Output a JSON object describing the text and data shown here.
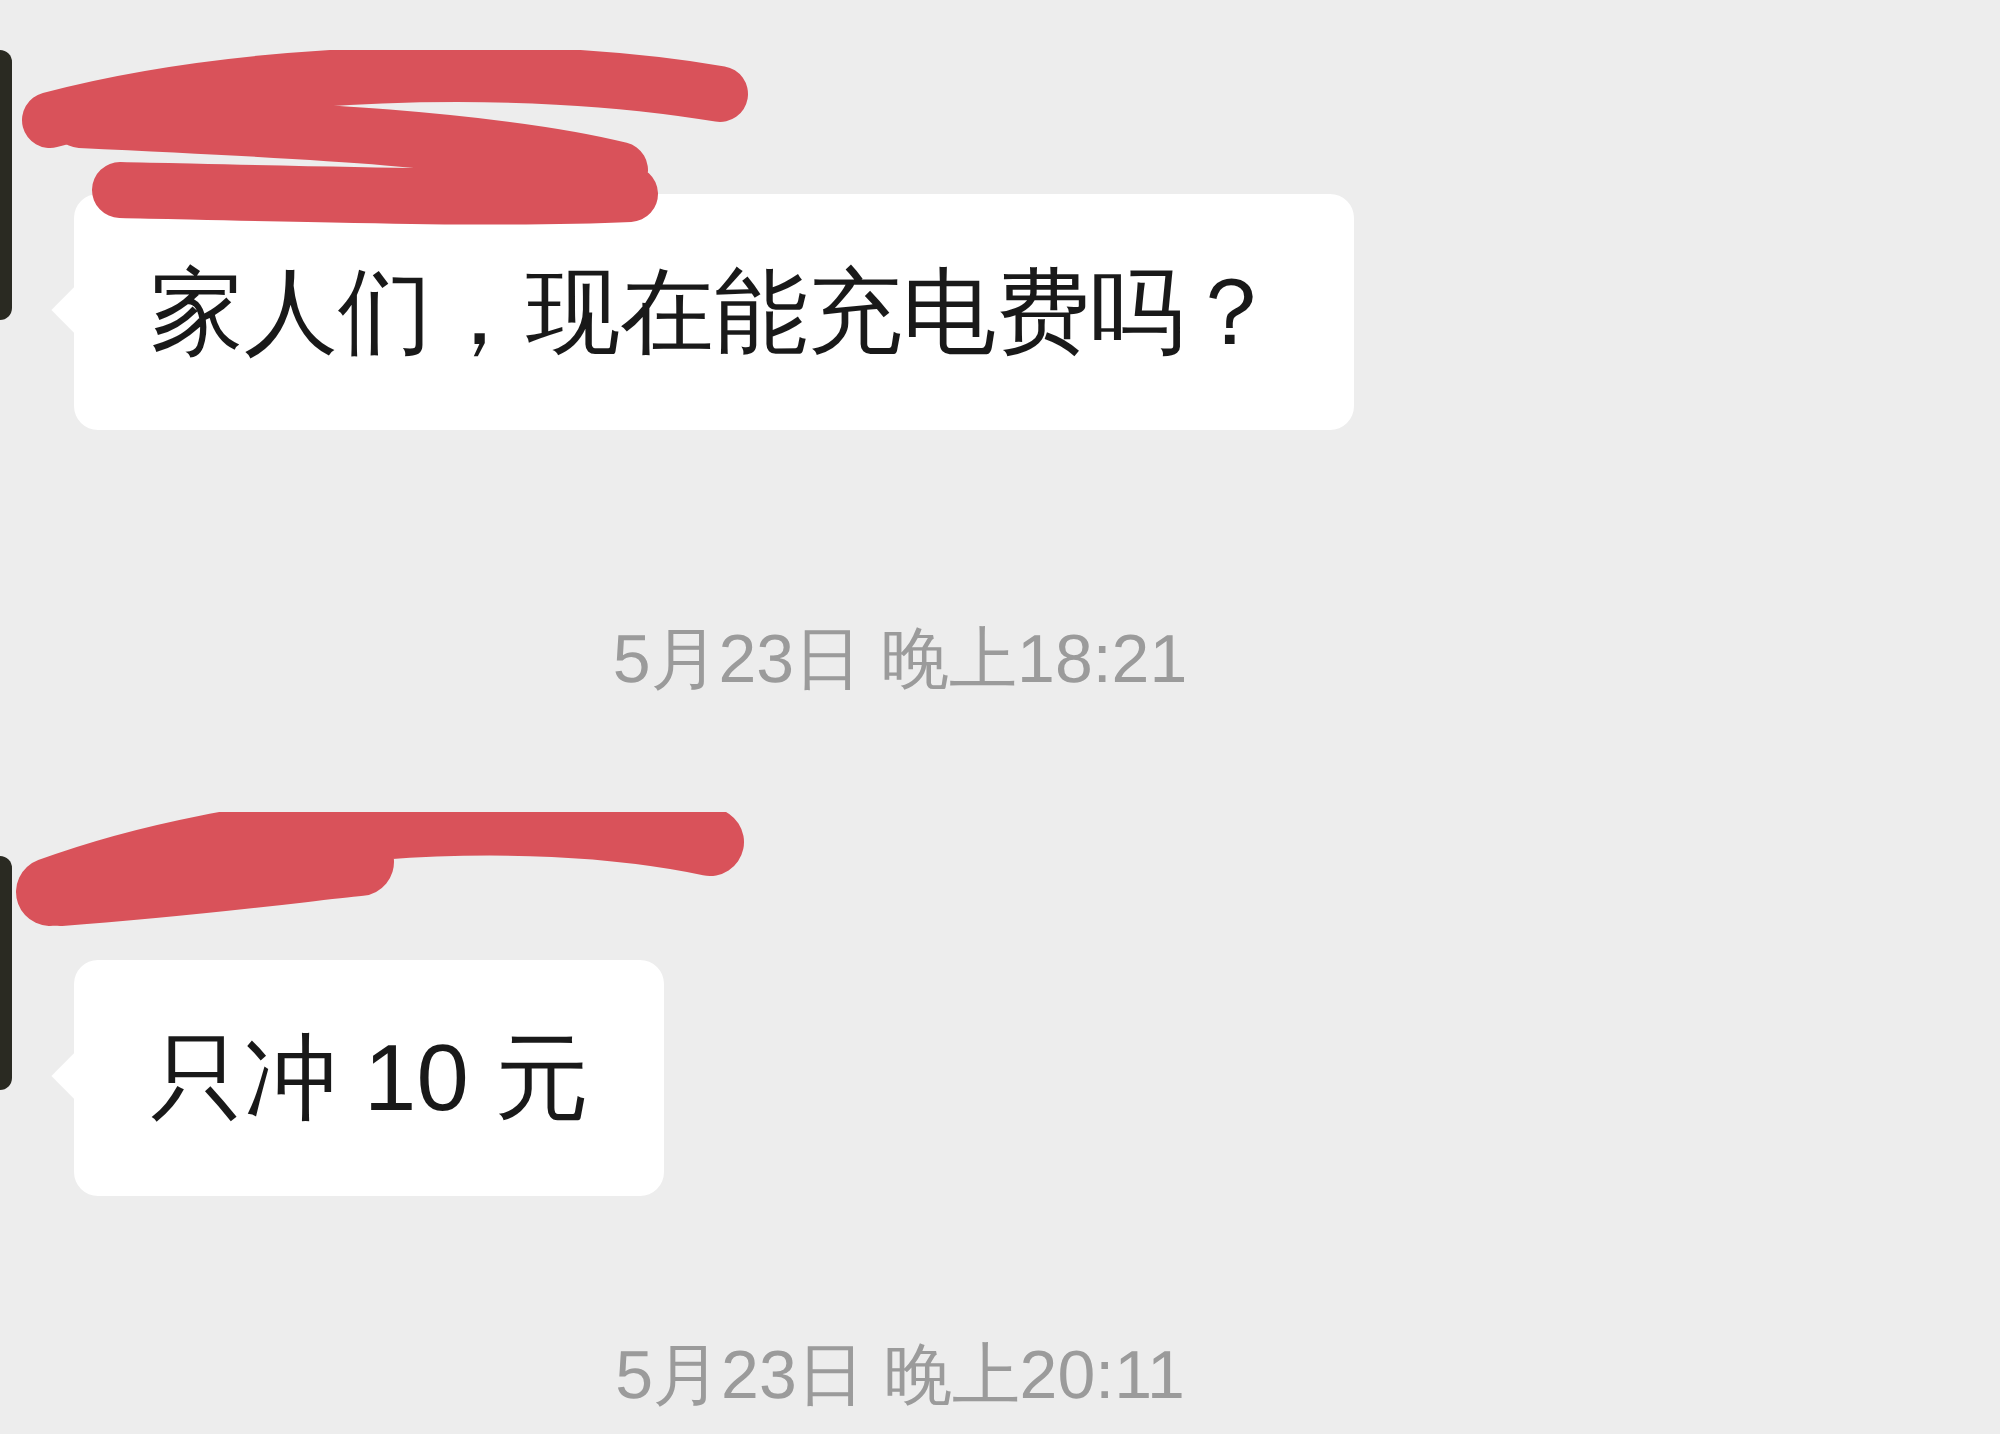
{
  "chat": [
    {
      "kind": "message",
      "text": "家人们，现在能充电费吗？"
    },
    {
      "kind": "timestamp",
      "text": "5月23日 晚上18:21"
    },
    {
      "kind": "message",
      "text": "只冲 10 元"
    },
    {
      "kind": "timestamp",
      "text": "5月23日 晚上20:11"
    }
  ]
}
